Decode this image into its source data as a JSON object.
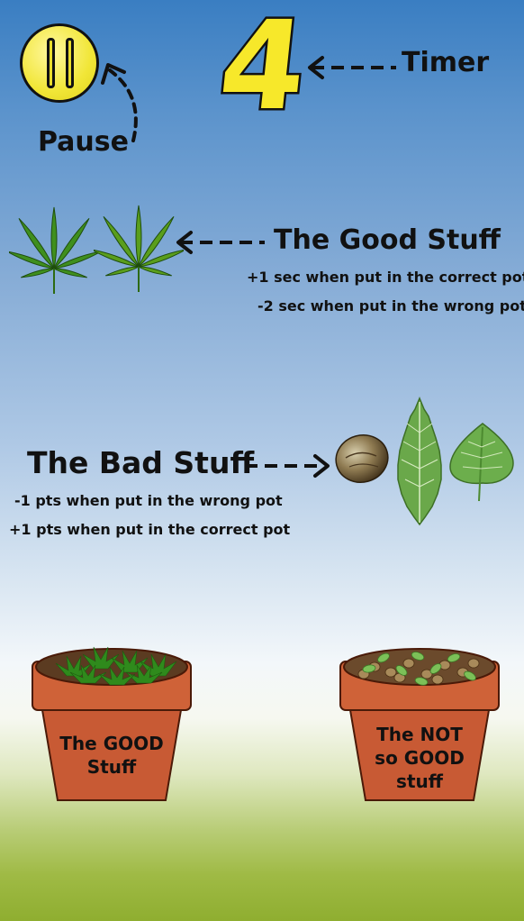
{
  "hud": {
    "pause_label": "Pause",
    "timer_value": "4",
    "timer_label": "Timer"
  },
  "good_stuff": {
    "title": "The Good Stuff",
    "rule_correct": "+1 sec when put in the correct pot",
    "rule_wrong": "-2 sec when put in the wrong pot"
  },
  "bad_stuff": {
    "title": "The Bad Stuff",
    "rule_wrong": "-1  pts when put in the wrong pot",
    "rule_correct": "+1  pts when put in the correct pot"
  },
  "pots": {
    "good_label_line1": "The GOOD",
    "good_label_line2": "Stuff",
    "bad_label_line1": "The NOT",
    "bad_label_line2": "so GOOD",
    "bad_label_line3": "stuff"
  },
  "colors": {
    "pause_yellow": "#f1e637",
    "timer_yellow": "#f7e82a",
    "pot_terracotta": "#c85a34",
    "leaf_green": "#3f8f1e"
  }
}
